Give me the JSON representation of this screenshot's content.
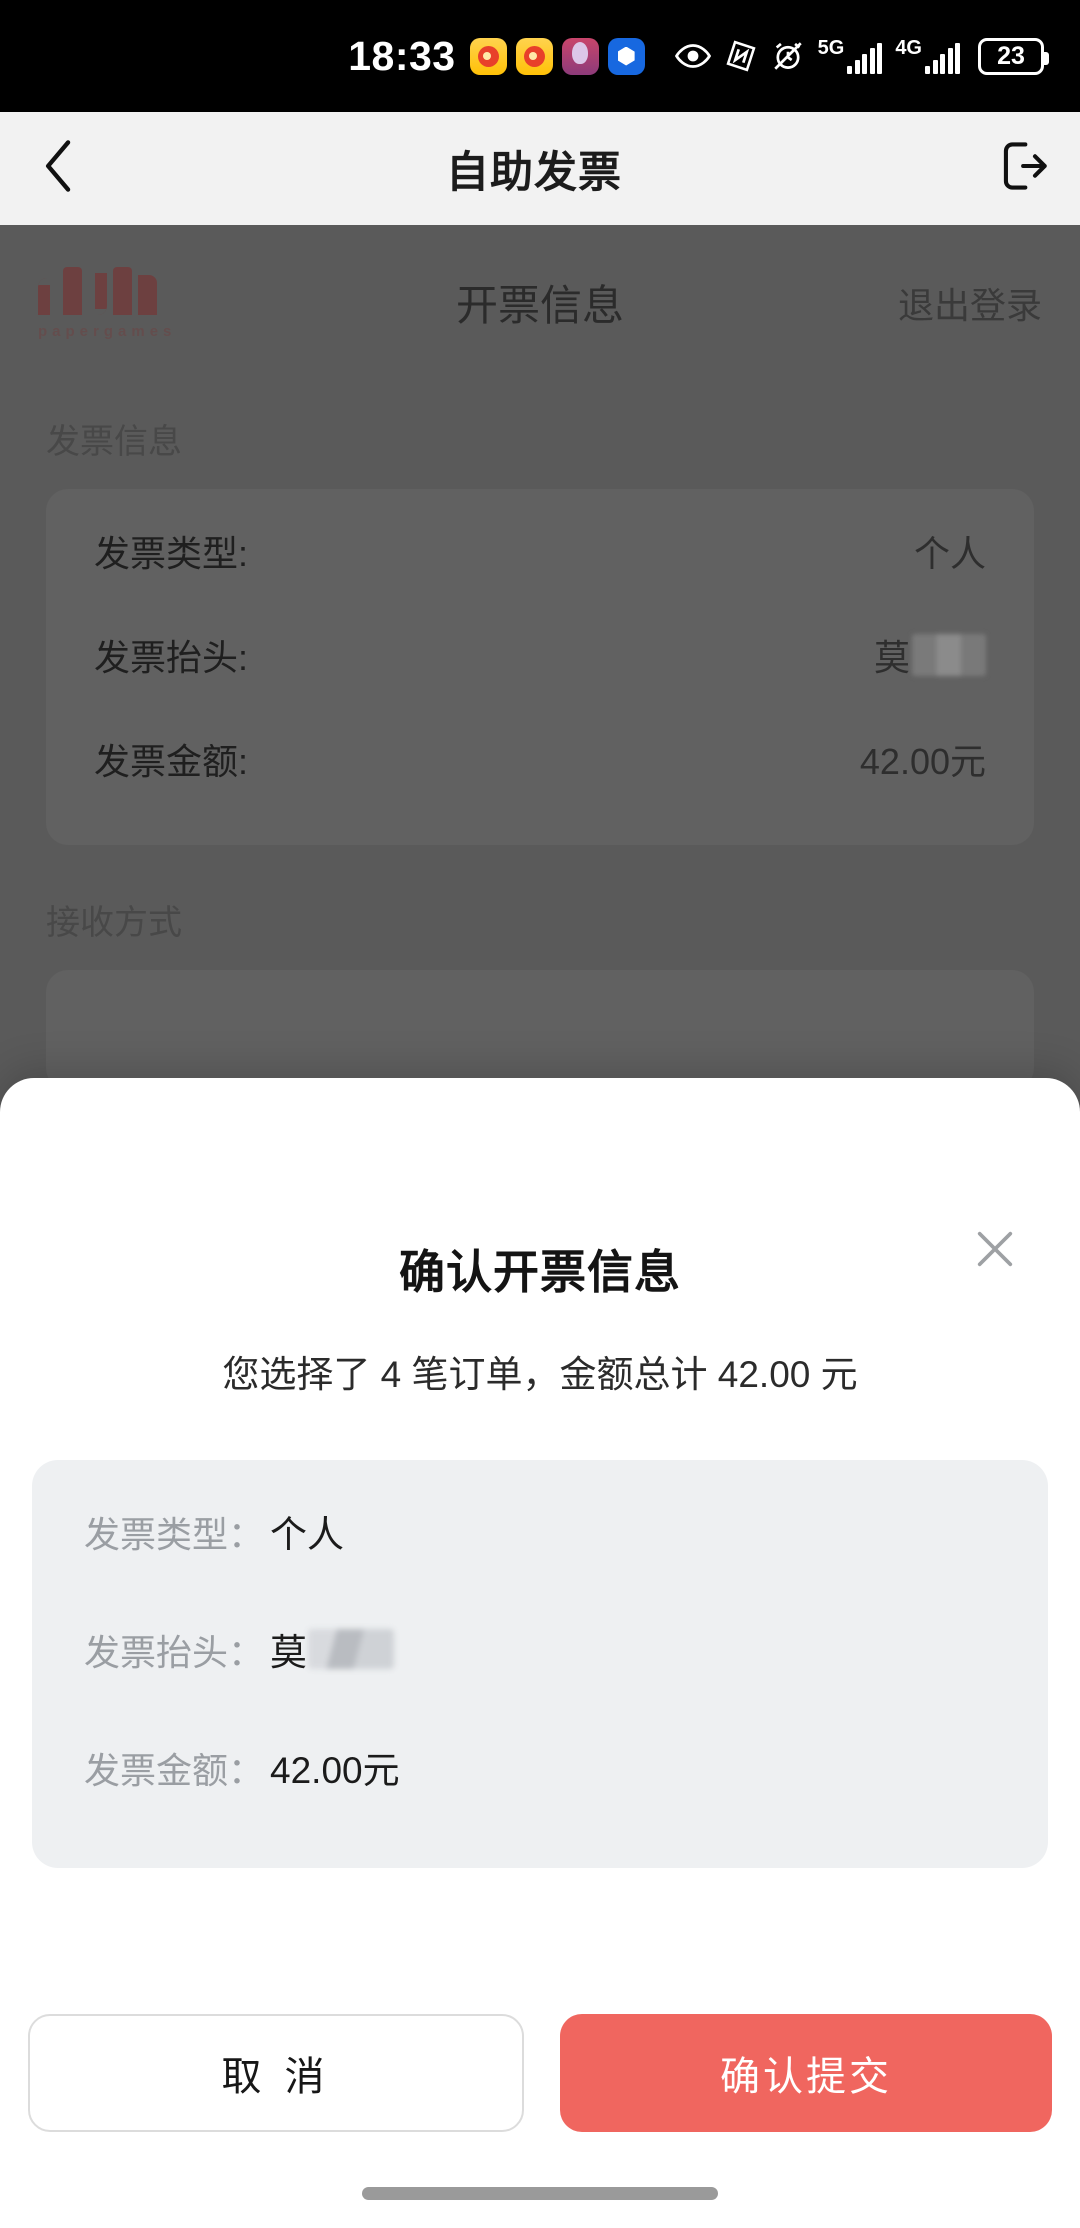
{
  "status_bar": {
    "time": "18:33",
    "battery_percent": "23",
    "network_primary": "5G",
    "network_secondary": "4G",
    "icons": [
      "weibo-app-icon",
      "weibo-app-icon",
      "photo-app-icon",
      "blue-app-icon",
      "eye-comfort-icon",
      "nfc-icon",
      "alarm-icon",
      "signal-5g-icon",
      "signal-4g-icon",
      "battery-icon"
    ]
  },
  "nav_bar": {
    "title": "自助发票",
    "back_icon": "chevron-left-icon",
    "exit_icon": "logout-icon"
  },
  "page": {
    "brand": "papergames",
    "header_title": "开票信息",
    "logout_label": "退出登录",
    "invoice_section_label": "发票信息",
    "invoice_rows": [
      {
        "label": "发票类型:",
        "value": "个人",
        "masked": false
      },
      {
        "label": "发票抬头:",
        "value": "莫",
        "masked": true
      },
      {
        "label": "发票金额:",
        "value": "42.00元",
        "masked": false
      }
    ],
    "receive_section_label": "接收方式"
  },
  "modal": {
    "title": "确认开票信息",
    "subtitle": "您选择了 4 笔订单，金额总计 42.00 元",
    "order_count": "4",
    "total_amount": "42.00",
    "close_icon": "close-icon",
    "rows": [
      {
        "label": "发票类型：",
        "value": "个人",
        "masked": false
      },
      {
        "label": "发票抬头：",
        "value": "莫",
        "masked": true
      },
      {
        "label": "发票金额：",
        "value": "42.00元",
        "masked": false
      }
    ],
    "cancel_label": "取 消",
    "submit_label": "确认提交",
    "accent_color": "#F0665F",
    "card_background": "#EEF0F2"
  }
}
